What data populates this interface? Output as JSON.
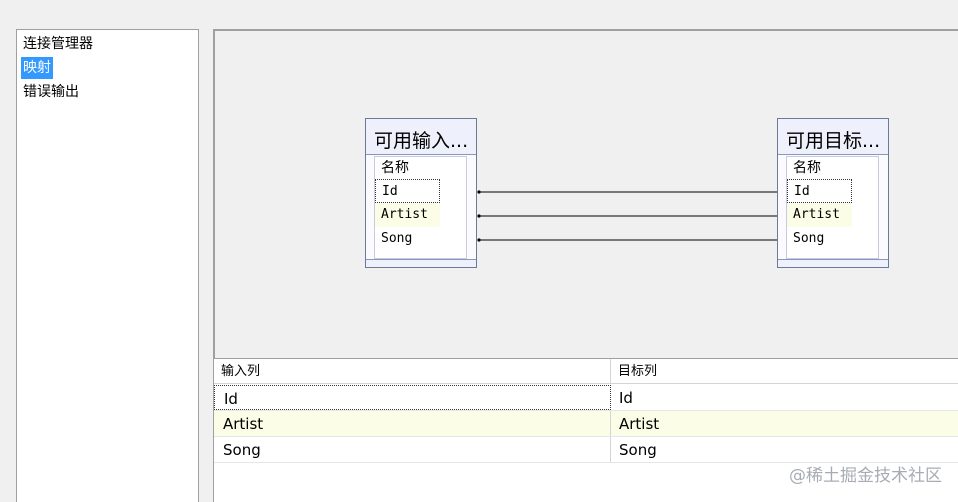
{
  "sidebar": {
    "items": [
      {
        "label": "连接管理器",
        "selected": false
      },
      {
        "label": "映射",
        "selected": true
      },
      {
        "label": "错误输出",
        "selected": false
      }
    ]
  },
  "diagram": {
    "source_table": {
      "title": "可用输入...",
      "header": "名称",
      "columns": [
        "Id",
        "Artist",
        "Song"
      ]
    },
    "target_table": {
      "title": "可用目标...",
      "header": "名称",
      "columns": [
        "Id",
        "Artist",
        "Song"
      ]
    },
    "mappings": [
      {
        "from": "Id",
        "to": "Id"
      },
      {
        "from": "Artist",
        "to": "Artist"
      },
      {
        "from": "Song",
        "to": "Song"
      }
    ]
  },
  "grid": {
    "headers": [
      "输入列",
      "目标列"
    ],
    "rows": [
      [
        "Id",
        "Id"
      ],
      [
        "Artist",
        "Artist"
      ],
      [
        "Song",
        "Song"
      ]
    ]
  },
  "watermark": "@稀土掘金技术社区",
  "colors": {
    "selection": "#3399ff",
    "alt_row": "#fcfde6",
    "table_header": "#eef1fc",
    "table_border": "#6b7a99"
  }
}
